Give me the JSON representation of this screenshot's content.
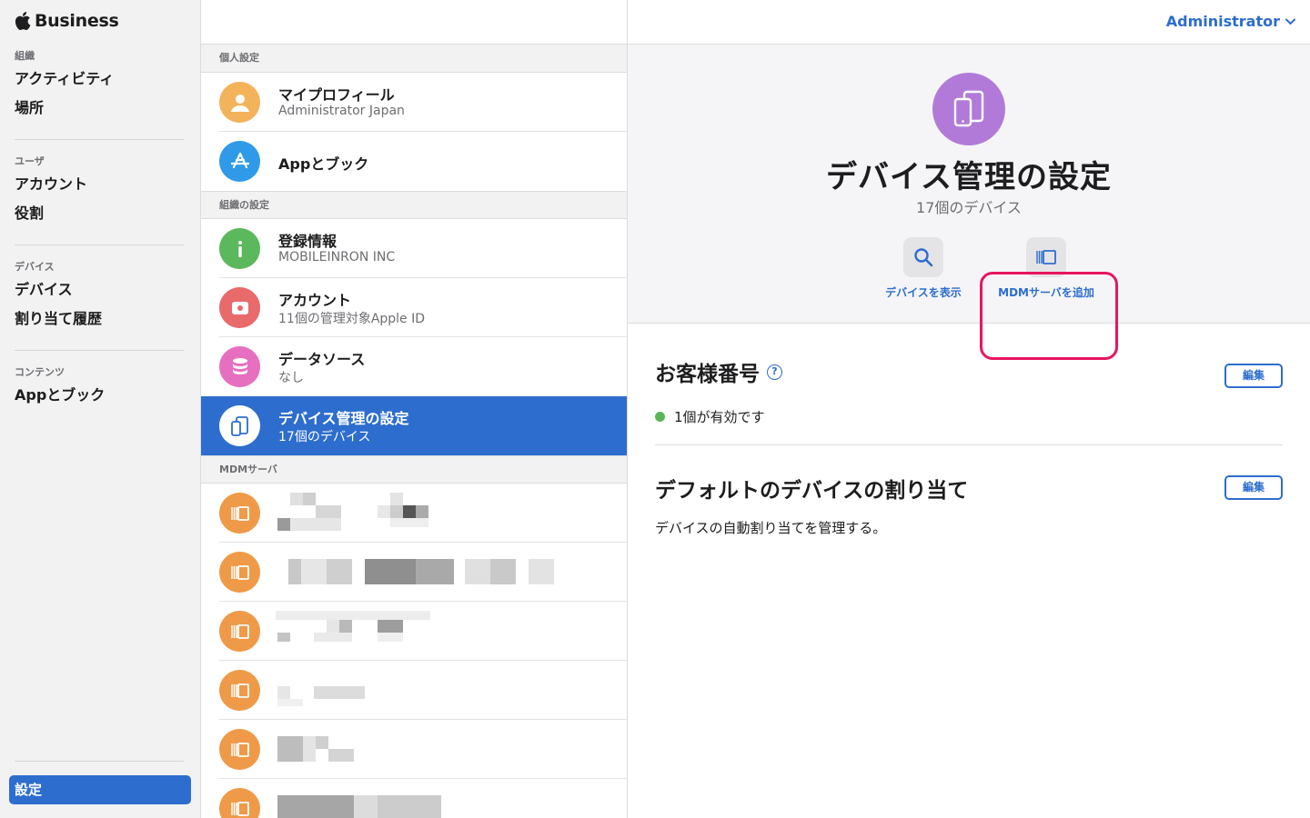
{
  "brand": {
    "name": "Business"
  },
  "sidebar": {
    "sections": [
      {
        "heading": "組織",
        "items": [
          "アクティビティ",
          "場所"
        ]
      },
      {
        "heading": "ユーザ",
        "items": [
          "アカウント",
          "役割"
        ]
      },
      {
        "heading": "デバイス",
        "items": [
          "デバイス",
          "割り当て履歴"
        ]
      },
      {
        "heading": "コンテンツ",
        "items": [
          "Appとブック"
        ]
      }
    ],
    "settings_label": "設定"
  },
  "middle": {
    "personal_heading": "個人設定",
    "profile": {
      "title": "マイプロフィール",
      "subtitle": "Administrator Japan"
    },
    "apps_books": {
      "title": "Appとブック"
    },
    "org_heading": "組織の設定",
    "registration": {
      "title": "登録情報",
      "subtitle": "MOBILEINRON INC"
    },
    "accounts": {
      "title": "アカウント",
      "subtitle": "11個の管理対象Apple ID"
    },
    "data_source": {
      "title": "データソース",
      "subtitle": "なし"
    },
    "device_mgmt": {
      "title": "デバイス管理の設定",
      "subtitle": "17個のデバイス"
    },
    "mdm_heading": "MDMサーバ"
  },
  "header": {
    "user_menu": "Administrator"
  },
  "detail": {
    "title": "デバイス管理の設定",
    "subtitle": "17個のデバイス",
    "actions": {
      "show_devices": "デバイスを表示",
      "add_mdm": "MDMサーバを追加"
    },
    "customer_number": {
      "title": "お客様番号",
      "help": "?",
      "edit": "編集",
      "status": "1個が有効です",
      "status_color": "#5ab55a"
    },
    "default_assignment": {
      "title": "デフォルトのデバイスの割り当て",
      "edit": "編集",
      "description": "デバイスの自動割り当てを管理する。"
    }
  },
  "colors": {
    "accent": "#2d6dce",
    "highlight": "#e8155f",
    "mdm_icon": "#ef9a48",
    "device_icon": "#b27ad8"
  }
}
